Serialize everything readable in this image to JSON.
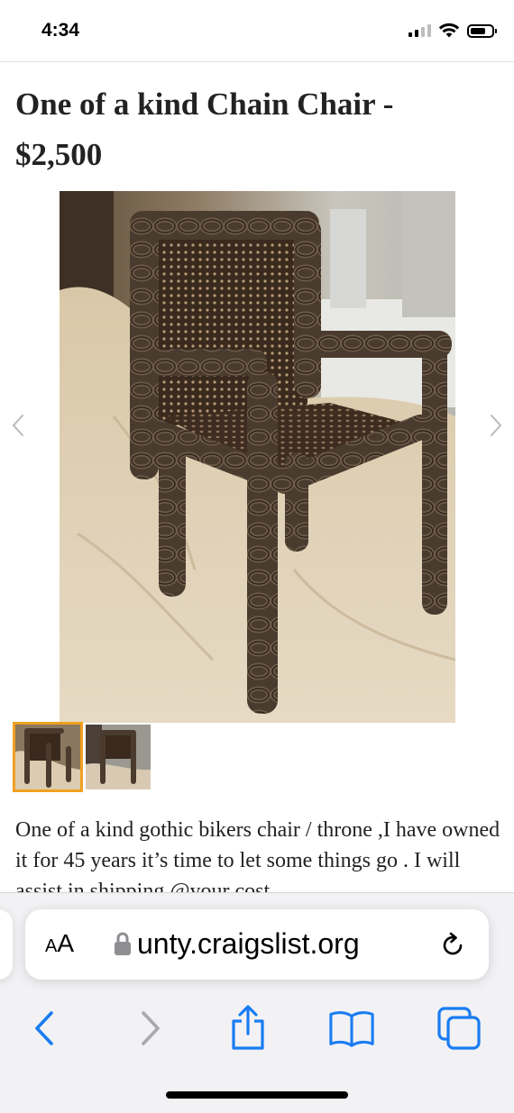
{
  "status_bar": {
    "time": "4:34",
    "icons": [
      "cellular-signal-icon",
      "wifi-icon",
      "battery-icon"
    ]
  },
  "post": {
    "title": "One of a kind Chain Chair - $2,500",
    "body": "One of a kind gothic bikers chair / throne ,I have owned it for 45 years it’s time to let some things go . I will assist in shipping @your cost",
    "gallery": {
      "photo_subject": "chain-chair-photo",
      "thumbnail_count": 2,
      "selected_thumbnail": 1,
      "selected_border_color": "#f0a020"
    }
  },
  "browser": {
    "text_size_label_small": "A",
    "text_size_label_large": "A",
    "url": "unty.craigslist.org",
    "accent_color": "#1a7cf2",
    "disabled_color": "#a8a8ad",
    "toolbar": [
      "back-icon",
      "forward-icon",
      "share-icon",
      "bookmarks-icon",
      "tabs-icon"
    ]
  }
}
